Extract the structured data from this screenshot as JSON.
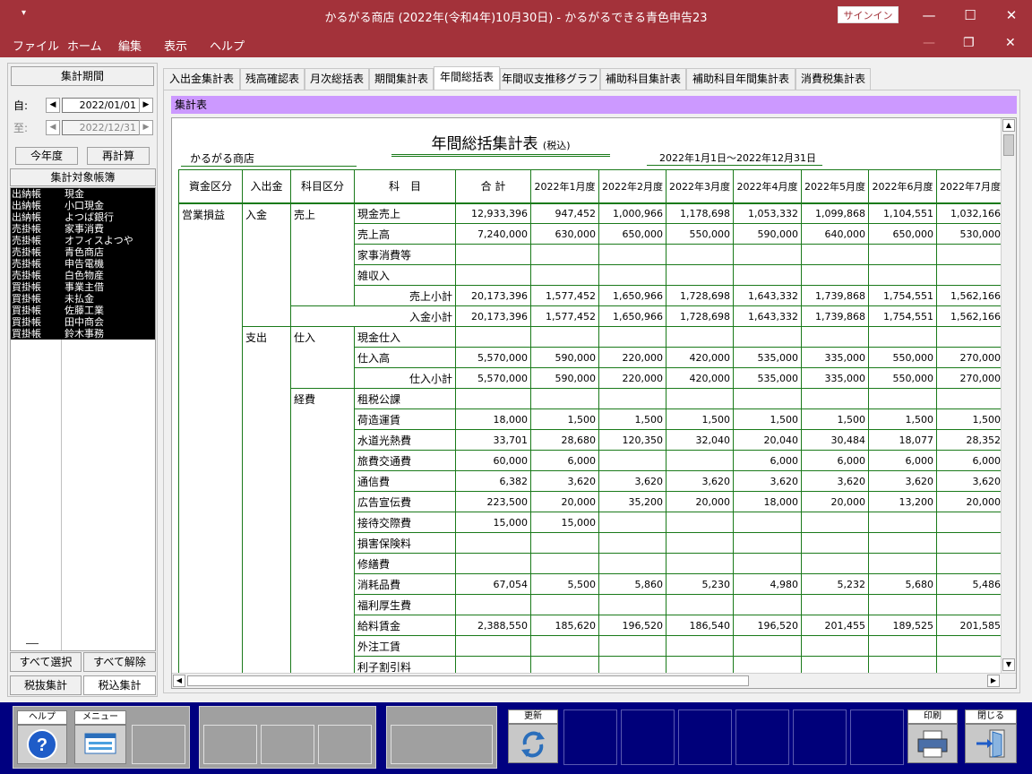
{
  "window": {
    "sysmenu": "▾",
    "title": "かるがる商店 (2022年(令和4年)10月30日)  -  かるがるできる青色申告23",
    "signin": "サインイン",
    "min": "—",
    "max": "☐",
    "close": "✕"
  },
  "menu": [
    "ファイル",
    "ホーム",
    "編集",
    "表示",
    "ヘルプ"
  ],
  "mdi": {
    "min": "—",
    "restore": "❐",
    "close": "✕"
  },
  "left": {
    "period_label": "集計期間",
    "from_label": "自:",
    "from_date": "2022/01/01",
    "to_label": "至:",
    "to_date": "2022/12/31",
    "this_year": "今年度",
    "recalc": "再計算",
    "books_label": "集計対象帳簿",
    "books": [
      {
        "type": "出納帳",
        "name": "現金"
      },
      {
        "type": "出納帳",
        "name": "小口現金"
      },
      {
        "type": "出納帳",
        "name": "よつば銀行"
      },
      {
        "type": "売掛帳",
        "name": "家事消費"
      },
      {
        "type": "売掛帳",
        "name": "オフィスよつや"
      },
      {
        "type": "売掛帳",
        "name": "青色商店"
      },
      {
        "type": "売掛帳",
        "name": "申告電機"
      },
      {
        "type": "売掛帳",
        "name": "白色物産"
      },
      {
        "type": "買掛帳",
        "name": "事業主借"
      },
      {
        "type": "買掛帳",
        "name": "未払金"
      },
      {
        "type": "買掛帳",
        "name": "佐藤工業"
      },
      {
        "type": "買掛帳",
        "name": "田中商会"
      },
      {
        "type": "買掛帳",
        "name": "鈴木事務"
      }
    ],
    "select_all": "すべて選択",
    "deselect_all": "すべて解除",
    "tax_excl": "税抜集計",
    "tax_incl": "税込集計"
  },
  "tabs": [
    "入出金集計表",
    "残高確認表",
    "月次総括表",
    "期間集計表",
    "年間総括表",
    "年間収支推移グラフ",
    "補助科目集計表",
    "補助科目年間集計表",
    "消費税集計表"
  ],
  "active_tab": "年間総括表",
  "section": "集計表",
  "report": {
    "title": "年間総括集計表",
    "title_sub": "(税込)",
    "shop": "かるがる商店",
    "period": "2022年1月1日～2022年12月31日",
    "headers": [
      "資金区分",
      "入出金",
      "科目区分",
      "科　目",
      "合 計",
      "2022年1月度",
      "2022年2月度",
      "2022年3月度",
      "2022年4月度",
      "2022年5月度",
      "2022年6月度",
      "2022年7月度"
    ],
    "fund": "営業損益",
    "dir_in": "入金",
    "dir_out": "支出",
    "cat_sales": "売上",
    "cat_purchase": "仕入",
    "cat_expense": "経費",
    "rows": [
      {
        "name": "現金売上",
        "v": [
          "12,933,396",
          "947,452",
          "1,000,966",
          "1,178,698",
          "1,053,332",
          "1,099,868",
          "1,104,551",
          "1,032,166"
        ]
      },
      {
        "name": "売上高",
        "v": [
          "7,240,000",
          "630,000",
          "650,000",
          "550,000",
          "590,000",
          "640,000",
          "650,000",
          "530,000"
        ]
      },
      {
        "name": "家事消費等",
        "v": [
          "",
          "",
          "",
          "",
          "",
          "",
          "",
          ""
        ]
      },
      {
        "name": "雑収入",
        "v": [
          "",
          "",
          "",
          "",
          "",
          "",
          "",
          ""
        ]
      },
      {
        "name": "売上小計",
        "v": [
          "20,173,396",
          "1,577,452",
          "1,650,966",
          "1,728,698",
          "1,643,332",
          "1,739,868",
          "1,754,551",
          "1,562,166"
        ]
      },
      {
        "name": "入金小計",
        "v": [
          "20,173,396",
          "1,577,452",
          "1,650,966",
          "1,728,698",
          "1,643,332",
          "1,739,868",
          "1,754,551",
          "1,562,166"
        ]
      },
      {
        "name": "現金仕入",
        "v": [
          "",
          "",
          "",
          "",
          "",
          "",
          "",
          ""
        ]
      },
      {
        "name": "仕入高",
        "v": [
          "5,570,000",
          "590,000",
          "220,000",
          "420,000",
          "535,000",
          "335,000",
          "550,000",
          "270,000"
        ]
      },
      {
        "name": "仕入小計",
        "v": [
          "5,570,000",
          "590,000",
          "220,000",
          "420,000",
          "535,000",
          "335,000",
          "550,000",
          "270,000"
        ]
      },
      {
        "name": "租税公課",
        "v": [
          "",
          "",
          "",
          "",
          "",
          "",
          "",
          ""
        ]
      },
      {
        "name": "荷造運賃",
        "v": [
          "18,000",
          "1,500",
          "1,500",
          "1,500",
          "1,500",
          "1,500",
          "1,500",
          "1,500"
        ]
      },
      {
        "name": "水道光熱費",
        "v": [
          "33,701",
          "28,680",
          "120,350",
          "32,040",
          "20,040",
          "30,484",
          "18,077",
          "28,352"
        ]
      },
      {
        "name": "旅費交通費",
        "v": [
          "60,000",
          "6,000",
          "",
          "",
          "6,000",
          "6,000",
          "6,000",
          "6,000"
        ]
      },
      {
        "name": "通信費",
        "v": [
          "6,382",
          "3,620",
          "3,620",
          "3,620",
          "3,620",
          "3,620",
          "3,620",
          "3,620"
        ]
      },
      {
        "name": "広告宣伝費",
        "v": [
          "223,500",
          "20,000",
          "35,200",
          "20,000",
          "18,000",
          "20,000",
          "13,200",
          "20,000"
        ]
      },
      {
        "name": "接待交際費",
        "v": [
          "15,000",
          "15,000",
          "",
          "",
          "",
          "",
          "",
          ""
        ]
      },
      {
        "name": "損害保険料",
        "v": [
          "",
          "",
          "",
          "",
          "",
          "",
          "",
          ""
        ]
      },
      {
        "name": "修繕費",
        "v": [
          "",
          "",
          "",
          "",
          "",
          "",
          "",
          ""
        ]
      },
      {
        "name": "消耗品費",
        "v": [
          "67,054",
          "5,500",
          "5,860",
          "5,230",
          "4,980",
          "5,232",
          "5,680",
          "5,486"
        ]
      },
      {
        "name": "福利厚生費",
        "v": [
          "",
          "",
          "",
          "",
          "",
          "",
          "",
          ""
        ]
      },
      {
        "name": "給料賃金",
        "v": [
          "2,388,550",
          "185,620",
          "196,520",
          "186,540",
          "196,520",
          "201,455",
          "189,525",
          "201,585"
        ]
      },
      {
        "name": "外注工賃",
        "v": [
          "",
          "",
          "",
          "",
          "",
          "",
          "",
          ""
        ]
      },
      {
        "name": "利子割引料",
        "v": [
          "",
          "",
          "",
          "",
          "",
          "",
          "",
          ""
        ]
      }
    ]
  },
  "fkeys": {
    "help": "ヘルプ",
    "menu": "メニュー",
    "update": "更新",
    "print": "印刷",
    "close": "閉じる"
  }
}
